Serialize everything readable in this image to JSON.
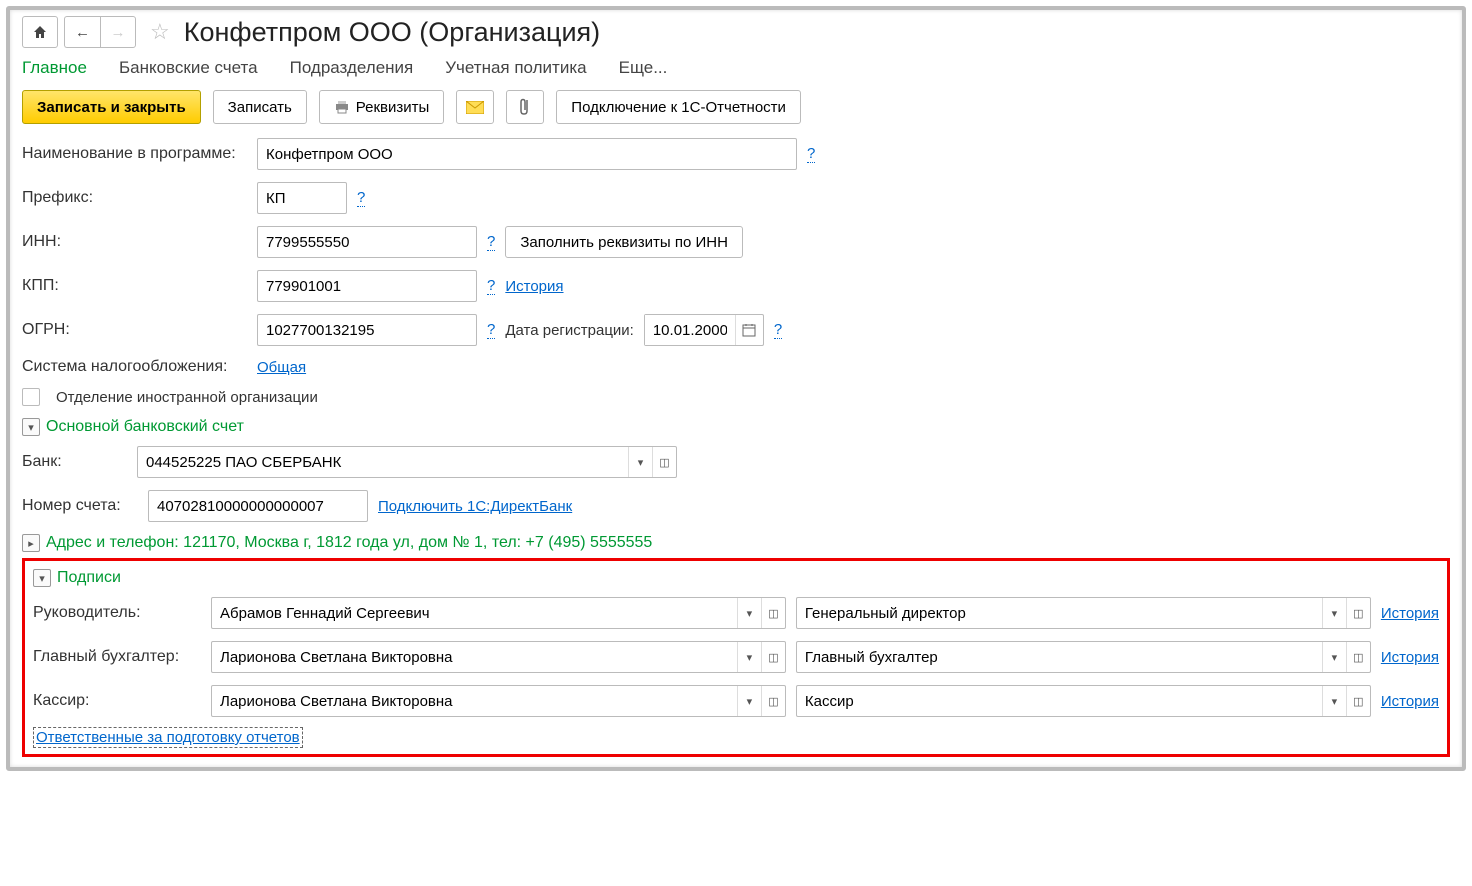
{
  "header": {
    "title": "Конфетпром ООО (Организация)"
  },
  "tabs": {
    "main": "Главное",
    "accounts": "Банковские счета",
    "divisions": "Подразделения",
    "policy": "Учетная политика",
    "more": "Еще..."
  },
  "toolbar": {
    "save_close": "Записать и закрыть",
    "save": "Записать",
    "requisites": "Реквизиты",
    "connect_1c": "Подключение к 1С-Отчетности"
  },
  "fields": {
    "name_label": "Наименование в программе:",
    "name_value": "Конфетпром ООО",
    "prefix_label": "Префикс:",
    "prefix_value": "КП",
    "inn_label": "ИНН:",
    "inn_value": "7799555550",
    "inn_fill_btn": "Заполнить реквизиты по ИНН",
    "kpp_label": "КПП:",
    "kpp_value": "779901001",
    "kpp_history": "История",
    "ogrn_label": "ОГРН:",
    "ogrn_value": "1027700132195",
    "reg_date_label": "Дата регистрации:",
    "reg_date_value": "10.01.2000",
    "tax_label": "Система налогообложения:",
    "tax_value": "Общая",
    "foreign_label": "Отделение иностранной организации"
  },
  "bank_section": {
    "title": "Основной банковский счет",
    "bank_label": "Банк:",
    "bank_value": "044525225 ПАО СБЕРБАНК",
    "acct_label": "Номер счета:",
    "acct_value": "40702810000000000007",
    "direct_link": "Подключить 1С:ДиректБанк"
  },
  "address_section": {
    "text": "Адрес и телефон: 121170, Москва г, 1812 года ул, дом № 1, тел: +7 (495) 5555555"
  },
  "signatures": {
    "title": "Подписи",
    "director_label": "Руководитель:",
    "director_name": "Абрамов Геннадий Сергеевич",
    "director_pos": "Генеральный директор",
    "accountant_label": "Главный бухгалтер:",
    "accountant_name": "Ларионова Светлана Викторовна",
    "accountant_pos": "Главный бухгалтер",
    "cashier_label": "Кассир:",
    "cashier_name": "Ларионова Светлана Викторовна",
    "cashier_pos": "Кассир",
    "history": "История",
    "responsible": "Ответственные за подготовку отчетов"
  },
  "help": "?"
}
